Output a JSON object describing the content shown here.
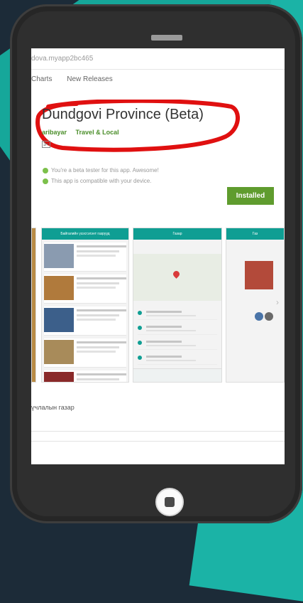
{
  "browser": {
    "url": "dova.myapp2bc465"
  },
  "nav": {
    "items": [
      "Charts",
      "New Releases"
    ]
  },
  "app": {
    "title": "Dundgovi Province (Beta)",
    "developer": "aribayar",
    "category": "Travel & Local",
    "badge": "3+"
  },
  "messages": {
    "beta": "You're a beta tester for this app. Awesome!",
    "compatible": "This app is compatible with your device."
  },
  "install_button": {
    "label": "Installed"
  },
  "screenshots": {
    "shot1_title": "Байгалийн үзэсгэлэнт газрууд",
    "shot2_title": "Газар",
    "shot3_title": "Газ"
  },
  "footer": {
    "text": "үчлалын газар"
  },
  "colors": {
    "accent": "#0f9e93",
    "install": "#5f9c2e",
    "annotation": "#e01010"
  }
}
